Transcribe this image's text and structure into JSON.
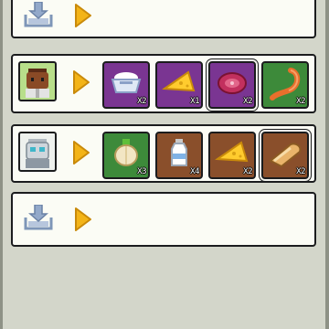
{
  "rows": [
    {
      "type": "empty",
      "icon": "download-tray-icon",
      "arrow": "play-arrow-icon"
    },
    {
      "type": "recipe",
      "character": "brown-haired-chef-icon",
      "character_bg": "#b8de8a",
      "items": [
        {
          "icon": "rice-bowl-icon",
          "color": "#7a3592",
          "qty": "X2",
          "selected": false
        },
        {
          "icon": "cheese-wedge-icon",
          "color": "#7a3592",
          "qty": "X1",
          "selected": false
        },
        {
          "icon": "raw-steak-icon",
          "color": "#7a3592",
          "qty": "X2",
          "selected": true
        },
        {
          "icon": "shrimp-icon",
          "color": "#3d8a3a",
          "qty": "X2",
          "selected": false
        }
      ]
    },
    {
      "type": "recipe",
      "character": "robot-chef-icon",
      "character_bg": "#eef1ee",
      "items": [
        {
          "icon": "onion-icon",
          "color": "#3d8a3a",
          "qty": "X3",
          "selected": false
        },
        {
          "icon": "milk-bottle-icon",
          "color": "#8a4f2b",
          "qty": "X4",
          "selected": false
        },
        {
          "icon": "cheese-wedge-icon",
          "color": "#8a4f2b",
          "qty": "X2",
          "selected": false
        },
        {
          "icon": "bread-loaf-icon",
          "color": "#8a4f2b",
          "qty": "X2",
          "selected": true
        }
      ]
    },
    {
      "type": "empty",
      "icon": "download-tray-icon",
      "arrow": "play-arrow-icon"
    }
  ],
  "colors": {
    "panel": "#d3d6ca",
    "row_bg": "#fbfcf5",
    "outline": "#1b1c1e",
    "arrow": "#f3b418"
  }
}
